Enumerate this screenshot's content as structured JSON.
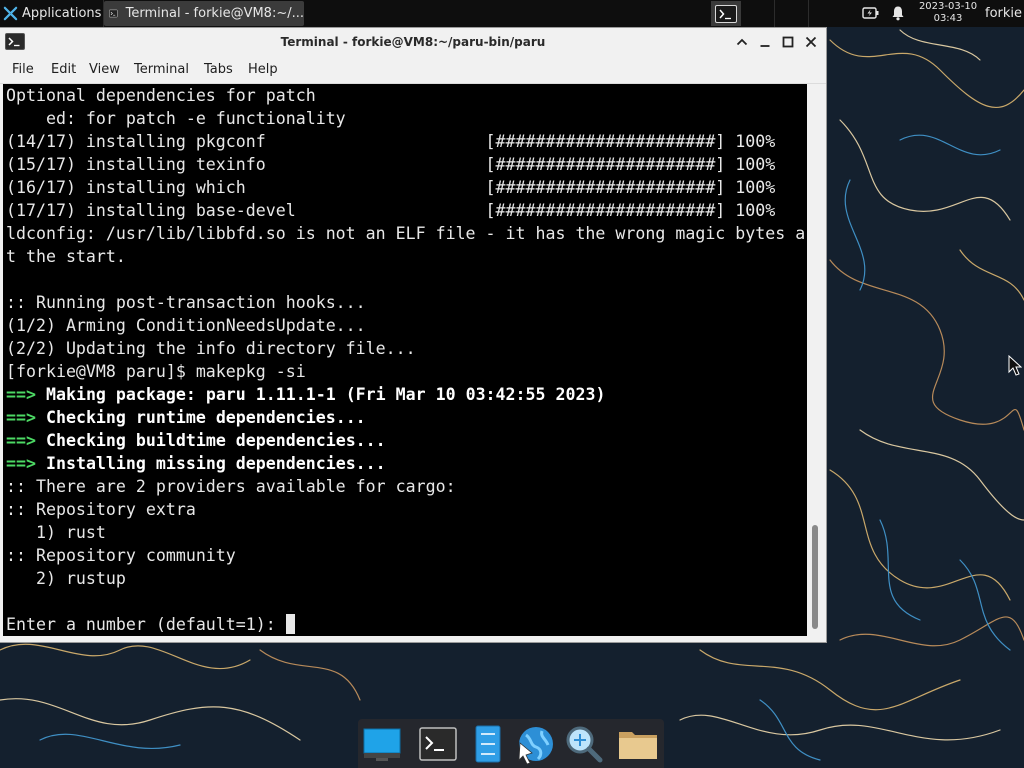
{
  "top_panel": {
    "applications_label": "Applications",
    "task_title": "Terminal - forkie@VM8:~/...",
    "clock_date": "2023-03-10",
    "clock_time": "03:43",
    "user_label": "forkie"
  },
  "window": {
    "title": "Terminal - forkie@VM8:~/paru-bin/paru",
    "menu": [
      "File",
      "Edit",
      "View",
      "Terminal",
      "Tabs",
      "Help"
    ]
  },
  "terminal": {
    "lines": [
      "Optional dependencies for patch",
      "    ed: for patch -e functionality",
      "(14/17) installing pkgconf                      [######################] 100%",
      "(15/17) installing texinfo                      [######################] 100%",
      "(16/17) installing which                        [######################] 100%",
      "(17/17) installing base-devel                   [######################] 100%",
      "ldconfig: /usr/lib/libbfd.so is not an ELF file - it has the wrong magic bytes a",
      "t the start.",
      "",
      ":: Running post-transaction hooks...",
      "(1/2) Arming ConditionNeedsUpdate...",
      "(2/2) Updating the info directory file...",
      "[forkie@VM8 paru]$ makepkg -si",
      "Making package: paru 1.11.1-1 (Fri Mar 10 03:42:55 2023)",
      "Checking runtime dependencies...",
      "Checking buildtime dependencies...",
      "Installing missing dependencies...",
      ":: There are 2 providers available for cargo:",
      ":: Repository extra",
      "   1) rust",
      ":: Repository community",
      "   2) rustup",
      "",
      "Enter a number (default=1): "
    ],
    "arrow": "==>",
    "arrow_lines": [
      13,
      14,
      15,
      16
    ],
    "prompt_line": 23
  },
  "dock": {
    "items": [
      "desktop-icon",
      "terminal-icon",
      "file-manager-icon",
      "web-browser-icon",
      "app-finder-icon",
      "folder-icon"
    ]
  },
  "colors": {
    "arrow": "#4cd964",
    "terminal_bg": "#000000",
    "terminal_fg": "#e8e8e8",
    "panel_bg": "#0e0e0e"
  }
}
